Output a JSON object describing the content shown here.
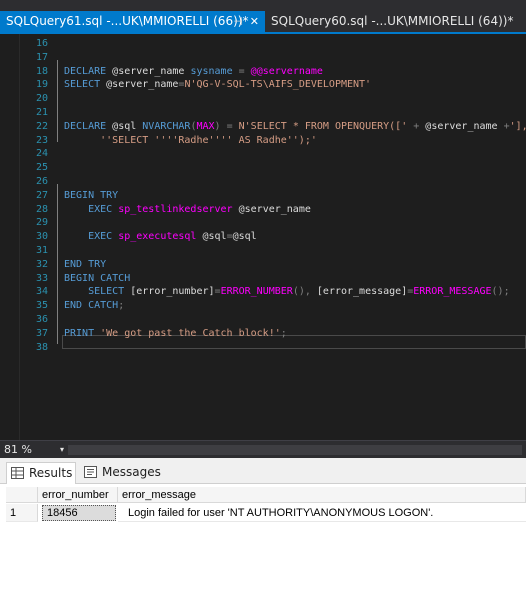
{
  "tabs": [
    {
      "label": "SQLQuery61.sql -...UK\\MMIORELLI (66))*",
      "pin": "⊣",
      "close": "✕"
    },
    {
      "label": "SQLQuery60.sql -...UK\\MMIORELLI (64))*"
    }
  ],
  "editor": {
    "lines": [
      {
        "n": "16",
        "tokens": []
      },
      {
        "n": "17",
        "tokens": []
      },
      {
        "n": "18",
        "tokens": [
          {
            "c": "k",
            "t": "DECLARE "
          },
          {
            "c": "t",
            "t": "@server_name "
          },
          {
            "c": "k",
            "t": "sysname "
          },
          {
            "c": "g",
            "t": "= "
          },
          {
            "c": "fn",
            "t": "@@servername"
          }
        ]
      },
      {
        "n": "19",
        "tokens": [
          {
            "c": "k",
            "t": "SELECT "
          },
          {
            "c": "t",
            "t": "@server_name"
          },
          {
            "c": "g",
            "t": "="
          },
          {
            "c": "s",
            "t": "N'QG-V-SQL-TS\\AIFS_DEVELOPMENT'"
          }
        ]
      },
      {
        "n": "20",
        "tokens": []
      },
      {
        "n": "21",
        "tokens": []
      },
      {
        "n": "22",
        "tokens": [
          {
            "c": "k",
            "t": "DECLARE "
          },
          {
            "c": "t",
            "t": "@sql "
          },
          {
            "c": "k",
            "t": "NVARCHAR"
          },
          {
            "c": "g",
            "t": "("
          },
          {
            "c": "fn",
            "t": "MAX"
          },
          {
            "c": "g",
            "t": ") = "
          },
          {
            "c": "s",
            "t": "N'SELECT * FROM OPENQUERY([' "
          },
          {
            "c": "g",
            "t": "+ "
          },
          {
            "c": "t",
            "t": "@server_name "
          },
          {
            "c": "g",
            "t": "+"
          },
          {
            "c": "s",
            "t": "'], "
          }
        ]
      },
      {
        "n": "23",
        "tokens": [
          {
            "c": "s",
            "t": "      ''SELECT ''''Radhe'''' AS Radhe'');'"
          }
        ]
      },
      {
        "n": "24",
        "tokens": []
      },
      {
        "n": "25",
        "tokens": []
      },
      {
        "n": "26",
        "tokens": []
      },
      {
        "n": "27",
        "tokens": [
          {
            "c": "k",
            "t": "BEGIN TRY"
          }
        ]
      },
      {
        "n": "28",
        "tokens": [
          {
            "c": "k",
            "t": "    EXEC "
          },
          {
            "c": "fn",
            "t": "sp_testlinkedserver "
          },
          {
            "c": "t",
            "t": "@server_name"
          }
        ]
      },
      {
        "n": "29",
        "tokens": []
      },
      {
        "n": "30",
        "tokens": [
          {
            "c": "k",
            "t": "    EXEC "
          },
          {
            "c": "fn",
            "t": "sp_executesql "
          },
          {
            "c": "t",
            "t": "@sql"
          },
          {
            "c": "g",
            "t": "="
          },
          {
            "c": "t",
            "t": "@sql"
          }
        ]
      },
      {
        "n": "31",
        "tokens": []
      },
      {
        "n": "32",
        "tokens": [
          {
            "c": "k",
            "t": "END TRY"
          }
        ]
      },
      {
        "n": "33",
        "tokens": [
          {
            "c": "k",
            "t": "BEGIN CATCH"
          }
        ]
      },
      {
        "n": "34",
        "tokens": [
          {
            "c": "k",
            "t": "    SELECT "
          },
          {
            "c": "t",
            "t": "[error_number]"
          },
          {
            "c": "g",
            "t": "="
          },
          {
            "c": "fn",
            "t": "ERROR_NUMBER"
          },
          {
            "c": "g",
            "t": "(), "
          },
          {
            "c": "t",
            "t": "[error_message]"
          },
          {
            "c": "g",
            "t": "="
          },
          {
            "c": "fn",
            "t": "ERROR_MESSAGE"
          },
          {
            "c": "g",
            "t": "();"
          }
        ]
      },
      {
        "n": "35",
        "tokens": [
          {
            "c": "k",
            "t": "END CATCH"
          },
          {
            "c": "g",
            "t": ";"
          }
        ]
      },
      {
        "n": "36",
        "tokens": []
      },
      {
        "n": "37",
        "tokens": [
          {
            "c": "k",
            "t": "PRINT "
          },
          {
            "c": "s",
            "t": "'We got past the Catch block!'"
          },
          {
            "c": "g",
            "t": ";"
          }
        ]
      },
      {
        "n": "38",
        "tokens": []
      }
    ]
  },
  "zoom": {
    "value": "81 %",
    "arrow": "▾"
  },
  "results_panel": {
    "tabs": [
      {
        "label": "Results"
      },
      {
        "label": "Messages"
      }
    ],
    "columns": [
      "error_number",
      "error_message"
    ],
    "rows": [
      {
        "num": "1",
        "cells": [
          "18456",
          "Login failed for user 'NT AUTHORITY\\ANONYMOUS LOGON'."
        ]
      }
    ]
  },
  "colors": {
    "keyword": "#569cd6",
    "string": "#d69d85",
    "system_function": "#ff00ff",
    "operator": "#808080",
    "line_number": "#2b91af",
    "active_tab": "#007acc"
  }
}
